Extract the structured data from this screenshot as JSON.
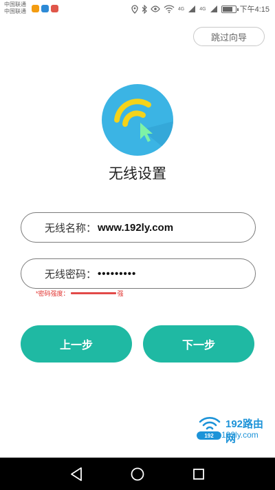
{
  "status_bar": {
    "carrier_line1": "中国联通",
    "carrier_line2": "中国联通",
    "network_4g_1": "4G",
    "network_4g_2": "4G",
    "battery_level": 0.8,
    "time": "下午4:15",
    "icons": [
      "weibo-icon",
      "telegram-icon",
      "game-icon",
      "location-icon",
      "bluetooth-icon",
      "eye-icon",
      "wifi-icon",
      "signal-icon",
      "battery-icon"
    ]
  },
  "header": {
    "skip_label": "跳过向导"
  },
  "page": {
    "title": "无线设置",
    "logo_icon": "wifi-setup-logo-icon"
  },
  "form": {
    "ssid_label": "无线名称：",
    "ssid_value": "www.192ly.com",
    "password_label": "无线密码：",
    "password_value": "•••••••••",
    "strength_label": "*密码强度：",
    "strength_level_text": "强",
    "strength_fraction": 1.0
  },
  "actions": {
    "prev_label": "上一步",
    "next_label": "下一步"
  },
  "watermark": {
    "title": "192路由网",
    "url": "192ly.com",
    "badge": "192"
  },
  "colors": {
    "accent": "#1fb9a3",
    "logo_bg": "#3bb4e4",
    "logo_arc": "#f5d31a",
    "danger": "#e0302c",
    "watermark": "#1d93d8"
  },
  "nav_bar": {
    "icons": [
      "back-icon",
      "home-icon",
      "recent-apps-icon"
    ]
  }
}
